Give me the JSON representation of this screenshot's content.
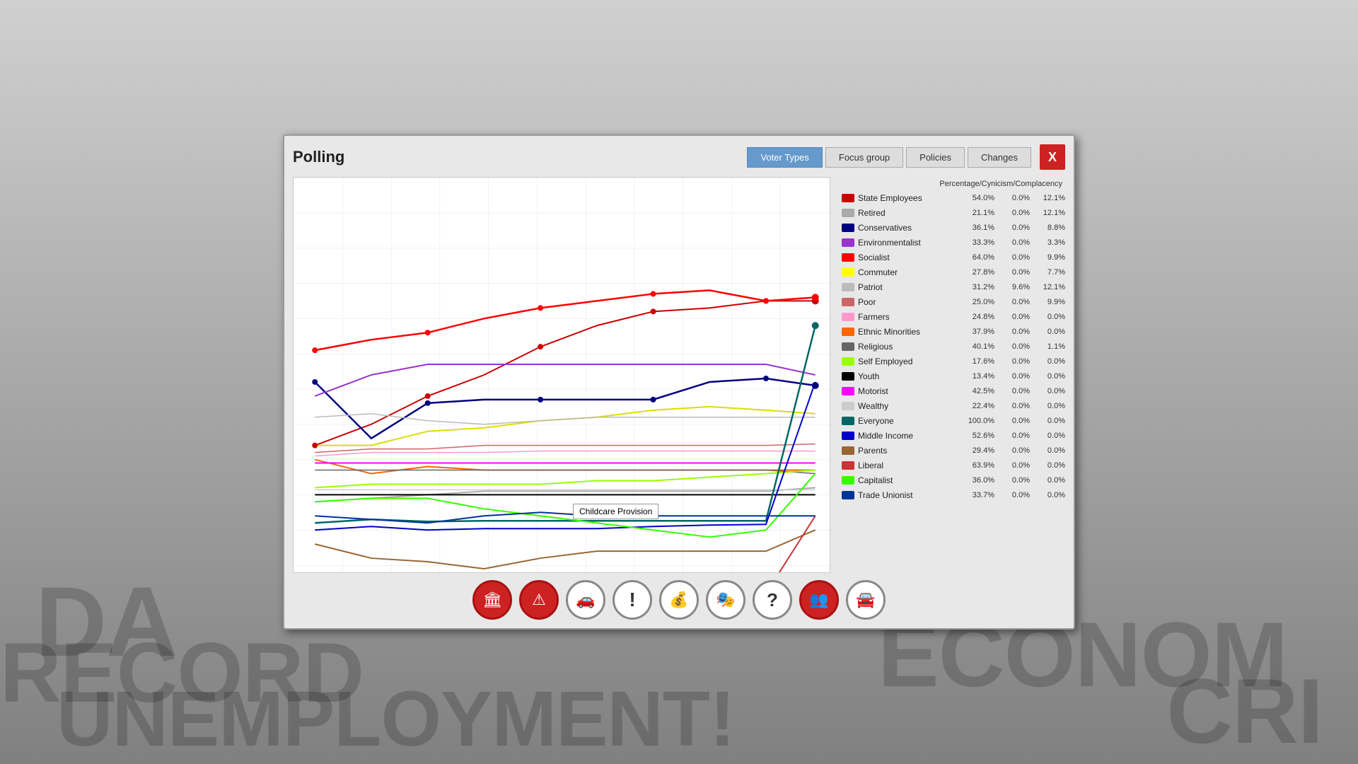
{
  "background": {
    "newspaper_words": [
      "DA",
      "RECORD",
      "UNEMPLOYMENT!",
      "ECONOM",
      "CRI"
    ]
  },
  "modal": {
    "title": "Polling",
    "tabs": [
      {
        "label": "Voter Types",
        "active": true
      },
      {
        "label": "Focus group",
        "active": false
      },
      {
        "label": "Policies",
        "active": false
      },
      {
        "label": "Changes",
        "active": false
      }
    ],
    "close_label": "X",
    "chart_header": "Percentage/Cynicism/Complacency",
    "legend": [
      {
        "name": "State Employees",
        "color": "#cc0000",
        "pct": "54.0%",
        "cyn": "0.0%",
        "comp": "12.1%"
      },
      {
        "name": "Retired",
        "color": "#aaaaaa",
        "pct": "21.1%",
        "cyn": "0.0%",
        "comp": "12.1%"
      },
      {
        "name": "Conservatives",
        "color": "#000080",
        "pct": "36.1%",
        "cyn": "0.0%",
        "comp": "8.8%"
      },
      {
        "name": "Environmentalist",
        "color": "#9933cc",
        "pct": "33.3%",
        "cyn": "0.0%",
        "comp": "3.3%"
      },
      {
        "name": "Socialist",
        "color": "#ff0000",
        "pct": "64.0%",
        "cyn": "0.0%",
        "comp": "9.9%"
      },
      {
        "name": "Commuter",
        "color": "#ffff00",
        "pct": "27.8%",
        "cyn": "0.0%",
        "comp": "7.7%"
      },
      {
        "name": "Patriot",
        "color": "#bbbbbb",
        "pct": "31.2%",
        "cyn": "9.6%",
        "comp": "12.1%"
      },
      {
        "name": "Poor",
        "color": "#cc6666",
        "pct": "25.0%",
        "cyn": "0.0%",
        "comp": "9.9%"
      },
      {
        "name": "Farmers",
        "color": "#ff99cc",
        "pct": "24.8%",
        "cyn": "0.0%",
        "comp": "0.0%"
      },
      {
        "name": "Ethnic Minorities",
        "color": "#ff6600",
        "pct": "37.9%",
        "cyn": "0.0%",
        "comp": "0.0%"
      },
      {
        "name": "Religious",
        "color": "#666666",
        "pct": "40.1%",
        "cyn": "0.0%",
        "comp": "1.1%"
      },
      {
        "name": "Self Employed",
        "color": "#99ff00",
        "pct": "17.6%",
        "cyn": "0.0%",
        "comp": "0.0%"
      },
      {
        "name": "Youth",
        "color": "#000000",
        "pct": "13.4%",
        "cyn": "0.0%",
        "comp": "0.0%"
      },
      {
        "name": "Motorist",
        "color": "#ff00ff",
        "pct": "42.5%",
        "cyn": "0.0%",
        "comp": "0.0%"
      },
      {
        "name": "Wealthy",
        "color": "#cccccc",
        "pct": "22.4%",
        "cyn": "0.0%",
        "comp": "0.0%"
      },
      {
        "name": "Everyone",
        "color": "#006666",
        "pct": "100.0%",
        "cyn": "0.0%",
        "comp": "0.0%"
      },
      {
        "name": "Middle Income",
        "color": "#0000cc",
        "pct": "52.6%",
        "cyn": "0.0%",
        "comp": "0.0%"
      },
      {
        "name": "Parents",
        "color": "#996633",
        "pct": "29.4%",
        "cyn": "0.0%",
        "comp": "0.0%"
      },
      {
        "name": "Liberal",
        "color": "#cc3333",
        "pct": "63.9%",
        "cyn": "0.0%",
        "comp": "0.0%"
      },
      {
        "name": "Capitalist",
        "color": "#33ff00",
        "pct": "36.0%",
        "cyn": "0.0%",
        "comp": "0.0%"
      },
      {
        "name": "Trade Unionist",
        "color": "#003399",
        "pct": "33.7%",
        "cyn": "0.0%",
        "comp": "0.0%"
      }
    ],
    "tooltip": "Childcare Provision",
    "bottom_icons": [
      {
        "icon": "🏛",
        "name": "icon-economy",
        "red": true
      },
      {
        "icon": "⚠",
        "name": "icon-warning",
        "red": true
      },
      {
        "icon": "🚗",
        "name": "icon-transport",
        "red": false
      },
      {
        "icon": "!",
        "name": "icon-exclamation",
        "red": false
      },
      {
        "icon": "💰",
        "name": "icon-money",
        "red": false
      },
      {
        "icon": "🎭",
        "name": "icon-culture",
        "red": false
      },
      {
        "icon": "?",
        "name": "icon-question",
        "red": false
      },
      {
        "icon": "👥",
        "name": "icon-people",
        "red": true
      },
      {
        "icon": "🚘",
        "name": "icon-car",
        "red": false
      }
    ]
  }
}
